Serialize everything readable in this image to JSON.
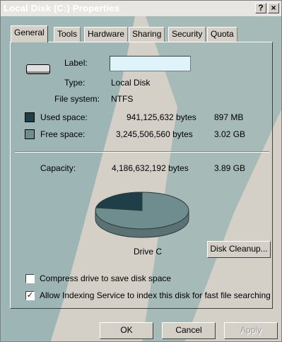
{
  "window": {
    "title": "Local Disk (C:) Properties",
    "help_glyph": "?",
    "close_glyph": "×"
  },
  "tabs": [
    {
      "label": "General"
    },
    {
      "label": "Tools"
    },
    {
      "label": "Hardware"
    },
    {
      "label": "Sharing"
    },
    {
      "label": "Security"
    },
    {
      "label": "Quota"
    }
  ],
  "general": {
    "label_caption": "Label:",
    "label_value": "",
    "type_caption": "Type:",
    "type_value": "Local Disk",
    "fs_caption": "File system:",
    "fs_value": "NTFS",
    "used_caption": "Used space:",
    "used_bytes": "941,125,632 bytes",
    "used_size": "897 MB",
    "free_caption": "Free space:",
    "free_bytes": "3,245,506,560 bytes",
    "free_size": "3.02 GB",
    "capacity_caption": "Capacity:",
    "capacity_bytes": "4,186,632,192 bytes",
    "capacity_size": "3.89 GB",
    "drive_caption": "Drive C",
    "cleanup_button": "Disk Cleanup...",
    "used_fraction": 0.225,
    "used_color": "#1f3f48",
    "free_color": "#6f8c8f"
  },
  "options": {
    "compress_label": "Compress drive to save disk space",
    "compress_checked": false,
    "index_label": "Allow Indexing Service to index this disk for fast file searching",
    "index_checked": true
  },
  "footer": {
    "ok": "OK",
    "cancel": "Cancel",
    "apply": "Apply"
  },
  "colors": {
    "watermark": "#6f9fa5"
  }
}
